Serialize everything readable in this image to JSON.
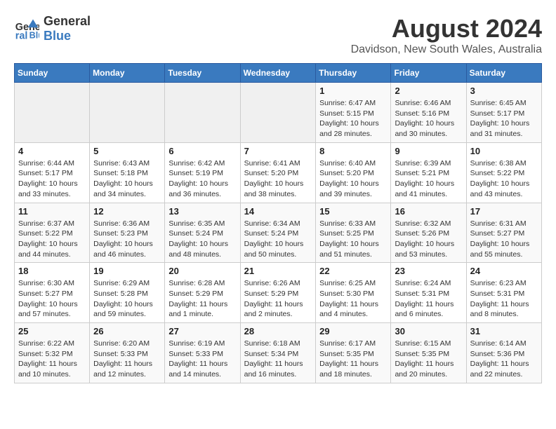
{
  "header": {
    "logo_line1": "General",
    "logo_line2": "Blue",
    "month_year": "August 2024",
    "location": "Davidson, New South Wales, Australia"
  },
  "days_of_week": [
    "Sunday",
    "Monday",
    "Tuesday",
    "Wednesday",
    "Thursday",
    "Friday",
    "Saturday"
  ],
  "weeks": [
    [
      {
        "day": "",
        "info": ""
      },
      {
        "day": "",
        "info": ""
      },
      {
        "day": "",
        "info": ""
      },
      {
        "day": "",
        "info": ""
      },
      {
        "day": "1",
        "info": "Sunrise: 6:47 AM\nSunset: 5:15 PM\nDaylight: 10 hours\nand 28 minutes."
      },
      {
        "day": "2",
        "info": "Sunrise: 6:46 AM\nSunset: 5:16 PM\nDaylight: 10 hours\nand 30 minutes."
      },
      {
        "day": "3",
        "info": "Sunrise: 6:45 AM\nSunset: 5:17 PM\nDaylight: 10 hours\nand 31 minutes."
      }
    ],
    [
      {
        "day": "4",
        "info": "Sunrise: 6:44 AM\nSunset: 5:17 PM\nDaylight: 10 hours\nand 33 minutes."
      },
      {
        "day": "5",
        "info": "Sunrise: 6:43 AM\nSunset: 5:18 PM\nDaylight: 10 hours\nand 34 minutes."
      },
      {
        "day": "6",
        "info": "Sunrise: 6:42 AM\nSunset: 5:19 PM\nDaylight: 10 hours\nand 36 minutes."
      },
      {
        "day": "7",
        "info": "Sunrise: 6:41 AM\nSunset: 5:20 PM\nDaylight: 10 hours\nand 38 minutes."
      },
      {
        "day": "8",
        "info": "Sunrise: 6:40 AM\nSunset: 5:20 PM\nDaylight: 10 hours\nand 39 minutes."
      },
      {
        "day": "9",
        "info": "Sunrise: 6:39 AM\nSunset: 5:21 PM\nDaylight: 10 hours\nand 41 minutes."
      },
      {
        "day": "10",
        "info": "Sunrise: 6:38 AM\nSunset: 5:22 PM\nDaylight: 10 hours\nand 43 minutes."
      }
    ],
    [
      {
        "day": "11",
        "info": "Sunrise: 6:37 AM\nSunset: 5:22 PM\nDaylight: 10 hours\nand 44 minutes."
      },
      {
        "day": "12",
        "info": "Sunrise: 6:36 AM\nSunset: 5:23 PM\nDaylight: 10 hours\nand 46 minutes."
      },
      {
        "day": "13",
        "info": "Sunrise: 6:35 AM\nSunset: 5:24 PM\nDaylight: 10 hours\nand 48 minutes."
      },
      {
        "day": "14",
        "info": "Sunrise: 6:34 AM\nSunset: 5:24 PM\nDaylight: 10 hours\nand 50 minutes."
      },
      {
        "day": "15",
        "info": "Sunrise: 6:33 AM\nSunset: 5:25 PM\nDaylight: 10 hours\nand 51 minutes."
      },
      {
        "day": "16",
        "info": "Sunrise: 6:32 AM\nSunset: 5:26 PM\nDaylight: 10 hours\nand 53 minutes."
      },
      {
        "day": "17",
        "info": "Sunrise: 6:31 AM\nSunset: 5:27 PM\nDaylight: 10 hours\nand 55 minutes."
      }
    ],
    [
      {
        "day": "18",
        "info": "Sunrise: 6:30 AM\nSunset: 5:27 PM\nDaylight: 10 hours\nand 57 minutes."
      },
      {
        "day": "19",
        "info": "Sunrise: 6:29 AM\nSunset: 5:28 PM\nDaylight: 10 hours\nand 59 minutes."
      },
      {
        "day": "20",
        "info": "Sunrise: 6:28 AM\nSunset: 5:29 PM\nDaylight: 11 hours\nand 1 minute."
      },
      {
        "day": "21",
        "info": "Sunrise: 6:26 AM\nSunset: 5:29 PM\nDaylight: 11 hours\nand 2 minutes."
      },
      {
        "day": "22",
        "info": "Sunrise: 6:25 AM\nSunset: 5:30 PM\nDaylight: 11 hours\nand 4 minutes."
      },
      {
        "day": "23",
        "info": "Sunrise: 6:24 AM\nSunset: 5:31 PM\nDaylight: 11 hours\nand 6 minutes."
      },
      {
        "day": "24",
        "info": "Sunrise: 6:23 AM\nSunset: 5:31 PM\nDaylight: 11 hours\nand 8 minutes."
      }
    ],
    [
      {
        "day": "25",
        "info": "Sunrise: 6:22 AM\nSunset: 5:32 PM\nDaylight: 11 hours\nand 10 minutes."
      },
      {
        "day": "26",
        "info": "Sunrise: 6:20 AM\nSunset: 5:33 PM\nDaylight: 11 hours\nand 12 minutes."
      },
      {
        "day": "27",
        "info": "Sunrise: 6:19 AM\nSunset: 5:33 PM\nDaylight: 11 hours\nand 14 minutes."
      },
      {
        "day": "28",
        "info": "Sunrise: 6:18 AM\nSunset: 5:34 PM\nDaylight: 11 hours\nand 16 minutes."
      },
      {
        "day": "29",
        "info": "Sunrise: 6:17 AM\nSunset: 5:35 PM\nDaylight: 11 hours\nand 18 minutes."
      },
      {
        "day": "30",
        "info": "Sunrise: 6:15 AM\nSunset: 5:35 PM\nDaylight: 11 hours\nand 20 minutes."
      },
      {
        "day": "31",
        "info": "Sunrise: 6:14 AM\nSunset: 5:36 PM\nDaylight: 11 hours\nand 22 minutes."
      }
    ]
  ]
}
